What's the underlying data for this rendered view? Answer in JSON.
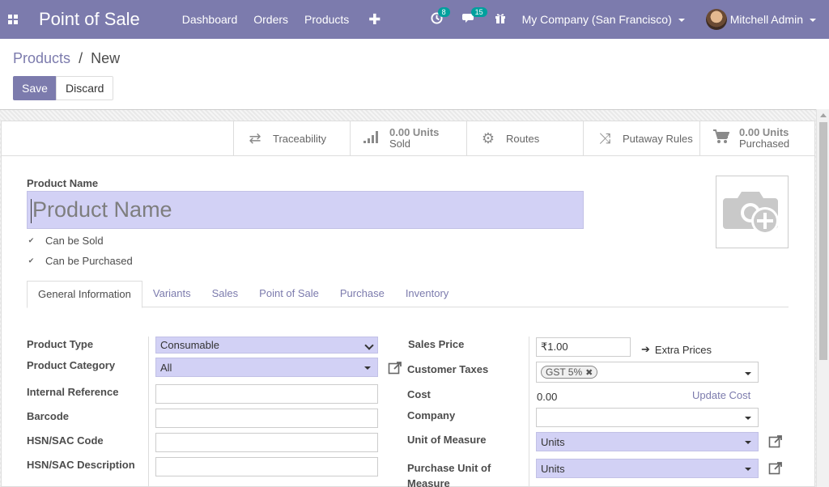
{
  "navbar": {
    "app_title": "Point of Sale",
    "menu": [
      "Dashboard",
      "Orders",
      "Products"
    ],
    "activity_count": "8",
    "messages_count": "15",
    "company": "My Company (San Francisco)",
    "user": "Mitchell Admin"
  },
  "breadcrumb": {
    "parent": "Products",
    "separator": "/",
    "current": "New"
  },
  "buttons": {
    "save": "Save",
    "discard": "Discard"
  },
  "smart_buttons": {
    "traceability": "Traceability",
    "sold_value": "0.00 Units",
    "sold_label": "Sold",
    "routes": "Routes",
    "putaway": "Putaway Rules",
    "purchased_value": "0.00 Units",
    "purchased_label": "Purchased"
  },
  "product": {
    "name_label": "Product Name",
    "name_placeholder": "Product Name",
    "can_be_sold": "Can be Sold",
    "can_be_purchased": "Can be Purchased"
  },
  "tabs": [
    "General Information",
    "Variants",
    "Sales",
    "Point of Sale",
    "Purchase",
    "Inventory"
  ],
  "left_fields": {
    "product_type_label": "Product Type",
    "product_type_value": "Consumable",
    "product_category_label": "Product Category",
    "product_category_value": "All",
    "internal_reference_label": "Internal Reference",
    "barcode_label": "Barcode",
    "hsn_code_label": "HSN/SAC Code",
    "hsn_desc_label": "HSN/SAC Description"
  },
  "right_fields": {
    "sales_price_label": "Sales Price",
    "sales_price_value": "₹1.00",
    "extra_prices": "Extra Prices",
    "customer_taxes_label": "Customer Taxes",
    "tax_tag": "GST 5%",
    "cost_label": "Cost",
    "cost_value": "0.00",
    "update_cost": "Update Cost",
    "company_label": "Company",
    "uom_label": "Unit of Measure",
    "uom_value": "Units",
    "purchase_uom_label_line1": "Purchase Unit of",
    "purchase_uom_label_line2": "Measure",
    "purchase_uom_value": "Units"
  },
  "colors": {
    "brand": "#7c7bad",
    "required_field": "#d2d1f5",
    "badge": "#00a09d"
  }
}
